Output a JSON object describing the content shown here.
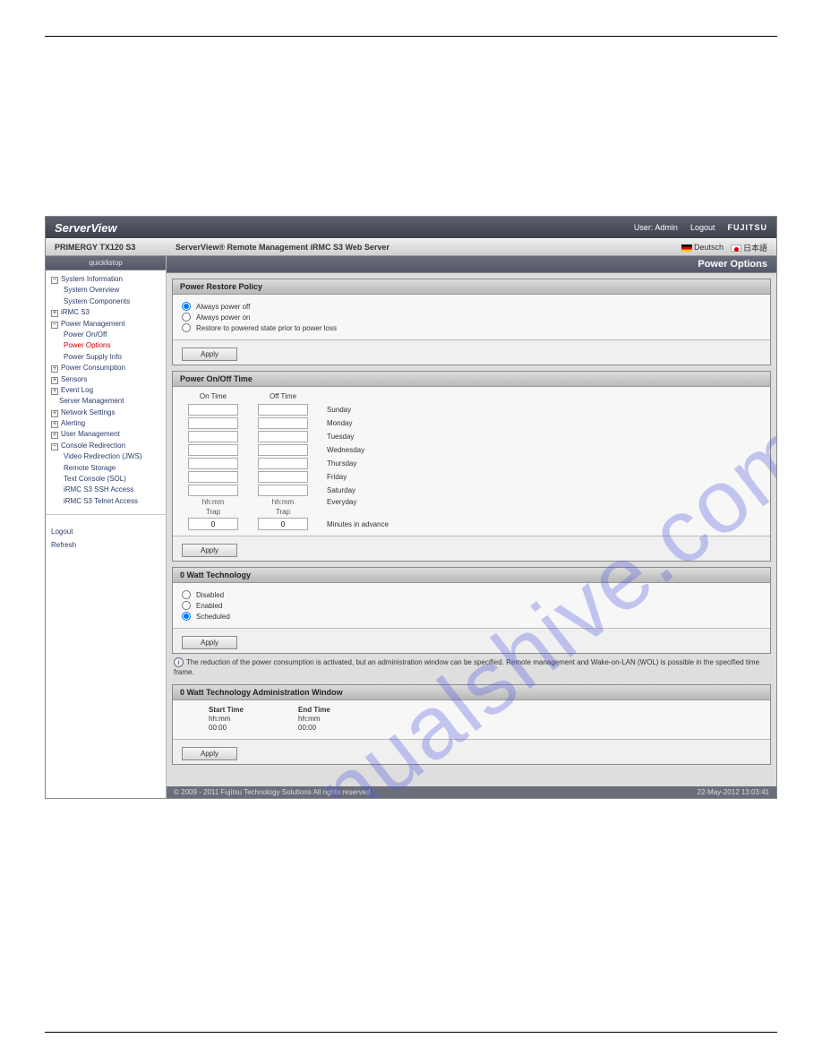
{
  "top_bar": {
    "brand": "ServerView",
    "user_label": "User: Admin",
    "logout": "Logout",
    "vendor": "FUJITSU"
  },
  "sub_bar": {
    "server": "PRIMERGY TX120 S3",
    "title": "ServerView® Remote Management iRMC S3 Web Server",
    "lang_de": "Deutsch",
    "lang_jp": "日本語"
  },
  "sidebar": {
    "header": "quicklistop",
    "items": {
      "sys_info": "System Information",
      "sys_overview": "System Overview",
      "sys_components": "System Components",
      "irmc_s3": "iRMC S3",
      "power_mgmt": "Power Management",
      "power_onoff": "Power On/Off",
      "power_options": "Power Options",
      "power_supply": "Power Supply Info",
      "power_consumption": "Power Consumption",
      "sensors": "Sensors",
      "event_log": "Event Log",
      "server_mgmt": "Server Management",
      "network": "Network Settings",
      "alerting": "Alerting",
      "user_mgmt": "User Management",
      "console": "Console Redirection",
      "video_redir": "Video Redirection (JWS)",
      "remote_storage": "Remote Storage",
      "text_console": "Text Console (SOL)",
      "ssh_access": "iRMC S3 SSH Access",
      "telnet_access": "iRMC S3 Telnet Access"
    },
    "logout": "Logout",
    "refresh": "Refresh"
  },
  "content": {
    "title": "Power Options",
    "restore": {
      "header": "Power Restore Policy",
      "opt_off": "Always power off",
      "opt_on": "Always power on",
      "opt_restore": "Restore to powered state prior to power loss",
      "apply": "Apply"
    },
    "schedule": {
      "header": "Power On/Off Time",
      "col_on": "On Time",
      "col_off": "Off Time",
      "days": [
        "Sunday",
        "Monday",
        "Tuesday",
        "Wednesday",
        "Thursday",
        "Friday",
        "Saturday",
        "Everyday"
      ],
      "hint": "hh:mm",
      "trap": "Trap",
      "trap_on": "0",
      "trap_off": "0",
      "minutes_label": "Minutes in advance",
      "apply": "Apply"
    },
    "watt": {
      "header": "0 Watt Technology",
      "disabled": "Disabled",
      "enabled": "Enabled",
      "scheduled": "Scheduled",
      "apply": "Apply"
    },
    "note": "The reduction of the power consumption is activated, but an administration window can be specified. Remote management and Wake-on-LAN (WOL) is possible in the specified time frame.",
    "admin": {
      "header": "0 Watt Technology Administration Window",
      "start": "Start Time",
      "end": "End Time",
      "hint": "hh:mm",
      "start_val": "00:00",
      "end_val": "00:00",
      "apply": "Apply"
    }
  },
  "footer": {
    "left": "© 2009 - 2011 Fujitsu Technology Solutions All rights reserved",
    "right": "22-May-2012 13:03:41"
  },
  "watermark": "manualshive.com"
}
